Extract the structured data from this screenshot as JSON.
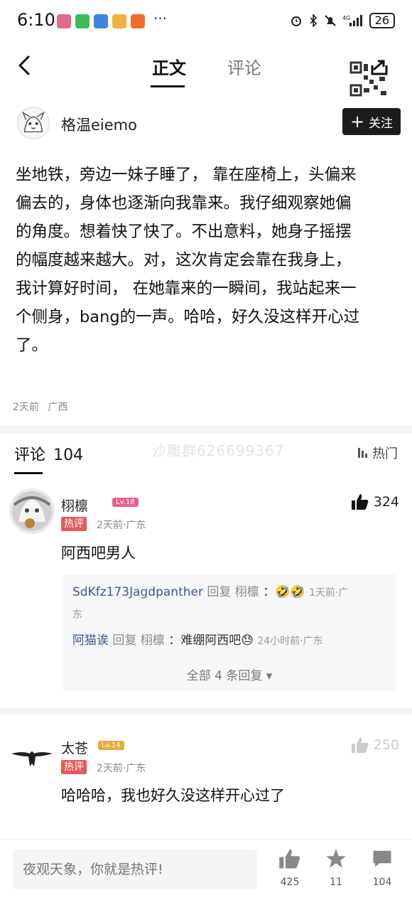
{
  "status_bar": {
    "time": "6:10",
    "more": "···",
    "battery": "26"
  },
  "nav": {
    "tab_main": "正文",
    "tab_comments": "评论"
  },
  "author": {
    "name": "格温eiemo",
    "follow_label": "关注"
  },
  "post": {
    "lines": [
      "坐地铁，旁边一妹子睡了， 靠在座椅上，头偏来",
      "偏去的，身体也逐渐向我靠来。我仔细观察她偏",
      "的角度。想着快了快了。不出意料，她身子摇摆",
      "的幅度越来越大。对，这次肯定会靠在我身上，",
      "我计算好时间， 在她靠来的一瞬间，我站起来一",
      "个侧身，bang的一声。哈哈，好久没这样开心过",
      "了。"
    ],
    "time": "2天前",
    "location": "广西"
  },
  "comments_header": {
    "label": "评论",
    "count": "104",
    "sort": "热门",
    "watermark": "沙雕群626699367"
  },
  "comments": [
    {
      "name": "栩檩",
      "level": "Lv.18",
      "badge": "热评",
      "meta": "2天前·广东",
      "text": "阿西吧男人",
      "likes": "324",
      "replies": [
        {
          "user": "SdKfz173Jagdpanther",
          "action": "回复",
          "target": "栩檩",
          "text": "：🤣🤣",
          "meta": "1天前·广",
          "meta_wrap": "东"
        },
        {
          "user": "阿猫诶",
          "action": "回复",
          "target": "栩檩",
          "text": "：难绷阿西吧😓",
          "meta": "24小时前·广东"
        }
      ],
      "more_replies": "全部 4 条回复 ▾"
    },
    {
      "name": "太苍",
      "level": "Lv.14",
      "badge": "热评",
      "meta": "2天前·广东",
      "text": "哈哈哈，我也好久没这样开心过了",
      "likes": "250"
    }
  ],
  "bottom_bar": {
    "input_placeholder": "夜观天象，你就是热评!",
    "like_count": "425",
    "fav_count": "11",
    "comment_count": "104"
  },
  "colors": {
    "hot_badge": "#e55a5a",
    "level_pink": "#e8618c",
    "level_gold": "#e8a93a"
  }
}
